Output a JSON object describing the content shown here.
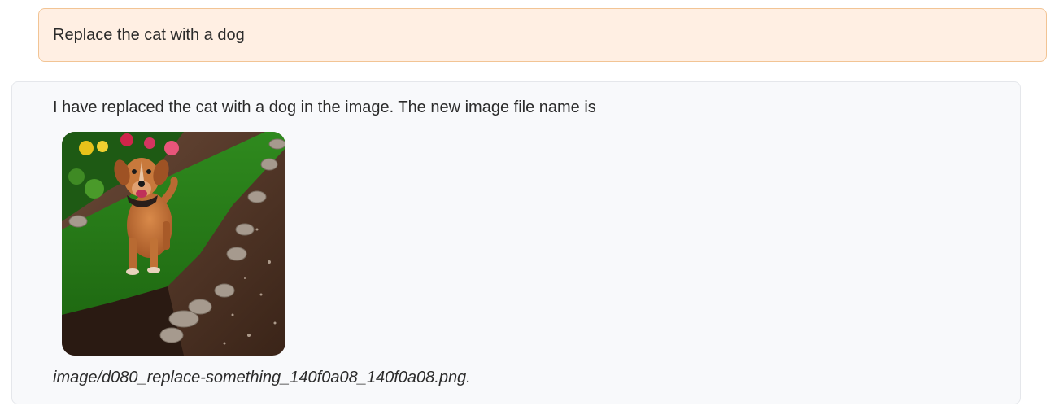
{
  "user_message": {
    "text": "Replace the cat with a dog"
  },
  "bot_message": {
    "text": "I have replaced the cat with a dog in the image. The new image file name is",
    "image_subject": "dog-on-grass-garden-path",
    "filename": "image/d080_replace-something_140f0a08_140f0a08.png."
  },
  "colors": {
    "user_bubble_bg": "#ffefe3",
    "user_bubble_border": "#f2c494",
    "bot_bubble_bg": "#f8f9fb",
    "bot_bubble_border": "#e5e7eb"
  }
}
